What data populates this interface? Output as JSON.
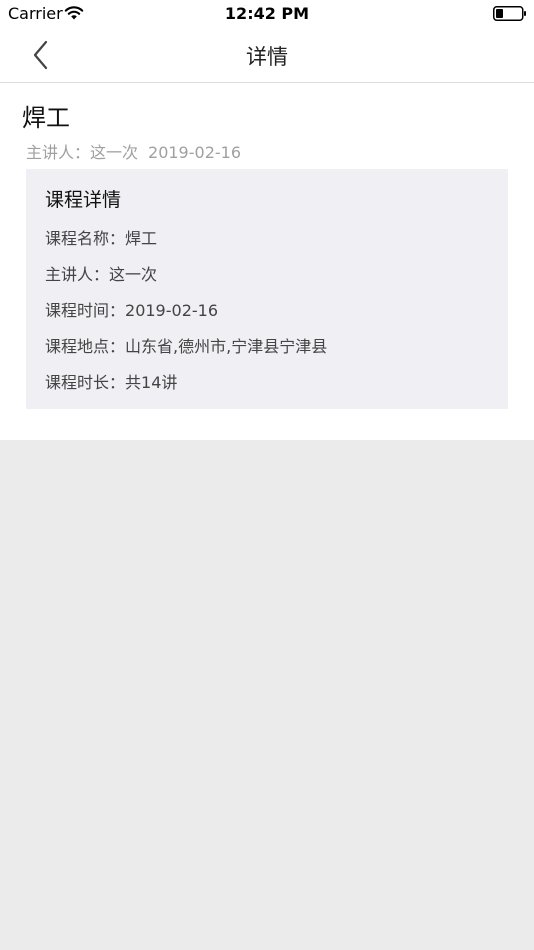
{
  "status_bar": {
    "carrier": "Carrier",
    "time": "12:42 PM"
  },
  "nav": {
    "title": "详情",
    "back_icon": "chevron-left-icon"
  },
  "course": {
    "title": "焊工",
    "speaker_line": "主讲人：这一次",
    "date": "2019-02-16"
  },
  "detail": {
    "heading": "课程详情",
    "rows": [
      {
        "label": "课程名称：",
        "value": "焊工"
      },
      {
        "label": "主讲人：",
        "value": "这一次"
      },
      {
        "label": "课程时间：",
        "value": "2019-02-16"
      },
      {
        "label": "课程地点：",
        "value": "山东省,德州市,宁津县宁津县"
      },
      {
        "label": "课程时长：",
        "value": "共14讲"
      }
    ]
  },
  "colors": {
    "background": "#ebebeb",
    "surface": "#ffffff",
    "card": "#efeff4",
    "muted_text": "#a0a0a0"
  }
}
